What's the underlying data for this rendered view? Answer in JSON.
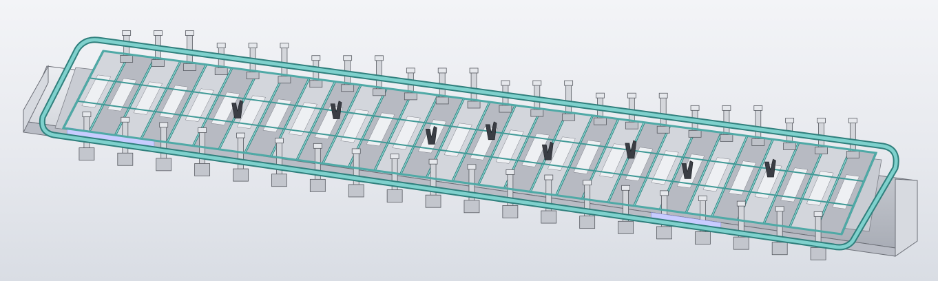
{
  "viewport": {
    "background_top": "#f3f4f7",
    "background_bottom": "#d9dde4"
  },
  "model": {
    "frame_color": "#5fb8b5",
    "frame_dark": "#2f7f7c",
    "base_color": "#c9ccd3",
    "base_shadow": "#8d9098",
    "accent_blue": "#c8ccff",
    "clamp_color": "#d2d4d9",
    "clamp_dark": "#5d6068",
    "rib_count": 30,
    "post_count_back": 24,
    "post_count_front": 20
  }
}
